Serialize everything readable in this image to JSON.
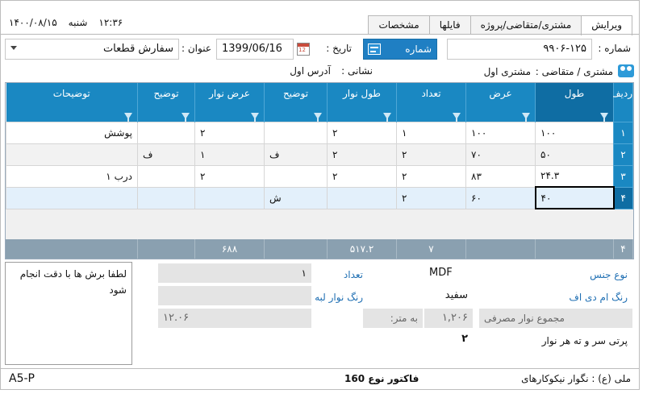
{
  "header": {
    "time": "۱۲:۳۶",
    "weekday": "شنبه",
    "date": "۱۴۰۰/۰۸/۱۵",
    "tabs": [
      "ویرایش",
      "مشتری/متقاضی/پروژه",
      "فایلها",
      "مشخصات"
    ]
  },
  "form": {
    "number_label": "شماره :",
    "number_value": "۹۹۰۶-۱۲۵",
    "new_number_button": "شماره جدید",
    "date_label": "تاریخ :",
    "date_value": "1399/06/16",
    "title_label": "عنوان :",
    "title_value": "سفارش قطعات",
    "customer_label": "مشتری / متقاضی :",
    "customer_value": "مشتری اول",
    "address_label": "نشانی :",
    "address_value": "آدرس اول"
  },
  "grid": {
    "columns": [
      "ردیف",
      "طول",
      "عرض",
      "تعداد",
      "طول نوار",
      "توضیح",
      "عرض نوار",
      "توضیح",
      "توضیحات"
    ],
    "rows": [
      [
        "۱",
        "۱۰۰",
        "۱۰۰",
        "۱",
        "۲",
        "",
        "۲",
        "",
        "پوشش"
      ],
      [
        "۲",
        "۵۰",
        "۷۰",
        "۲",
        "۲",
        "ف",
        "۱",
        "ف",
        ""
      ],
      [
        "۳",
        "۲۴.۳",
        "۸۳",
        "۲",
        "۲",
        "",
        "۲",
        "",
        "درب ۱"
      ],
      [
        "۴",
        "۴۰",
        "۶۰",
        "۲",
        "",
        "ش",
        "",
        "",
        ""
      ]
    ],
    "summary": [
      "۴",
      "",
      "",
      "۷",
      "۵۱۷.۲",
      "",
      "۶۸۸",
      "",
      ""
    ]
  },
  "details": {
    "material_label": "نوع جنس",
    "material_value": "MDF",
    "count_label": "تعداد",
    "count_value": "۱",
    "mdf_color_label": "رنگ ام دی اف",
    "mdf_color_value": "سفید",
    "edge_color_label": "رنگ نوار لبه",
    "edge_total_label": "مجموع نوار مصرفی",
    "edge_total_value": "۱,۲۰۶",
    "per_meter_label": "به متر:",
    "per_meter_value": "۱۲.۰۶",
    "waste_label": "پرتی سر و ته هر نوار",
    "waste_value": "۲",
    "note_text": "لطفا برش ها با دقت انجام شود"
  },
  "status": {
    "left": "A5-P",
    "invoice": "فاکتور نوع 160",
    "right": "ملی (ع) : نگوار نیکوکارهای"
  }
}
